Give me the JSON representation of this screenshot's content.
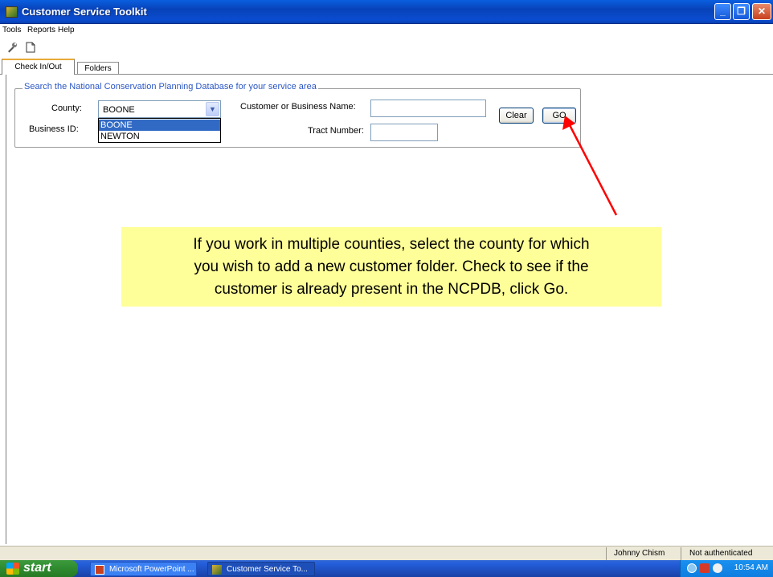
{
  "window": {
    "title": "Customer Service Toolkit",
    "controls": {
      "minimize": "_",
      "maximize": "❐",
      "close": "✕"
    }
  },
  "menu": [
    "Tools",
    "Reports",
    "Help"
  ],
  "toolbar": {
    "icons": [
      "tools-icon",
      "new-document-icon"
    ]
  },
  "tabs": [
    {
      "label": "Check In/Out",
      "active": true
    },
    {
      "label": "Folders",
      "active": false
    }
  ],
  "search": {
    "legend": "Search the National Conservation Planning Database for your service area",
    "county_label": "County:",
    "county_value": "BOONE",
    "county_options": [
      "BOONE",
      "NEWTON"
    ],
    "county_selected_option": "BOONE",
    "business_id_label": "Business ID:",
    "customer_name_label": "Customer or Business Name:",
    "customer_name_value": "",
    "tract_number_label": "Tract Number:",
    "tract_number_value": "",
    "clear_label": "Clear",
    "go_label": "GO"
  },
  "callout": {
    "lines": [
      "If you work in multiple counties, select the county for which",
      "you wish to add a new customer folder. Check to see if the",
      "customer is already present in the NCPDB, click Go."
    ],
    "background": "#ffff99",
    "arrow_color": "#ff0000"
  },
  "statusbar": {
    "user": "Johnny Chism",
    "auth": "Not authenticated"
  },
  "taskbar": {
    "start_label": "start",
    "tasks": [
      {
        "label": "Microsoft PowerPoint ...",
        "icon": "powerpoint-icon"
      },
      {
        "label": "Customer Service To...",
        "icon": "toolkit-icon",
        "active": true
      }
    ],
    "clock": "10:54 AM"
  },
  "colors": {
    "titlebar": "#0a4cd0",
    "legend_text": "#2b56c4",
    "selection": "#316ac5"
  }
}
